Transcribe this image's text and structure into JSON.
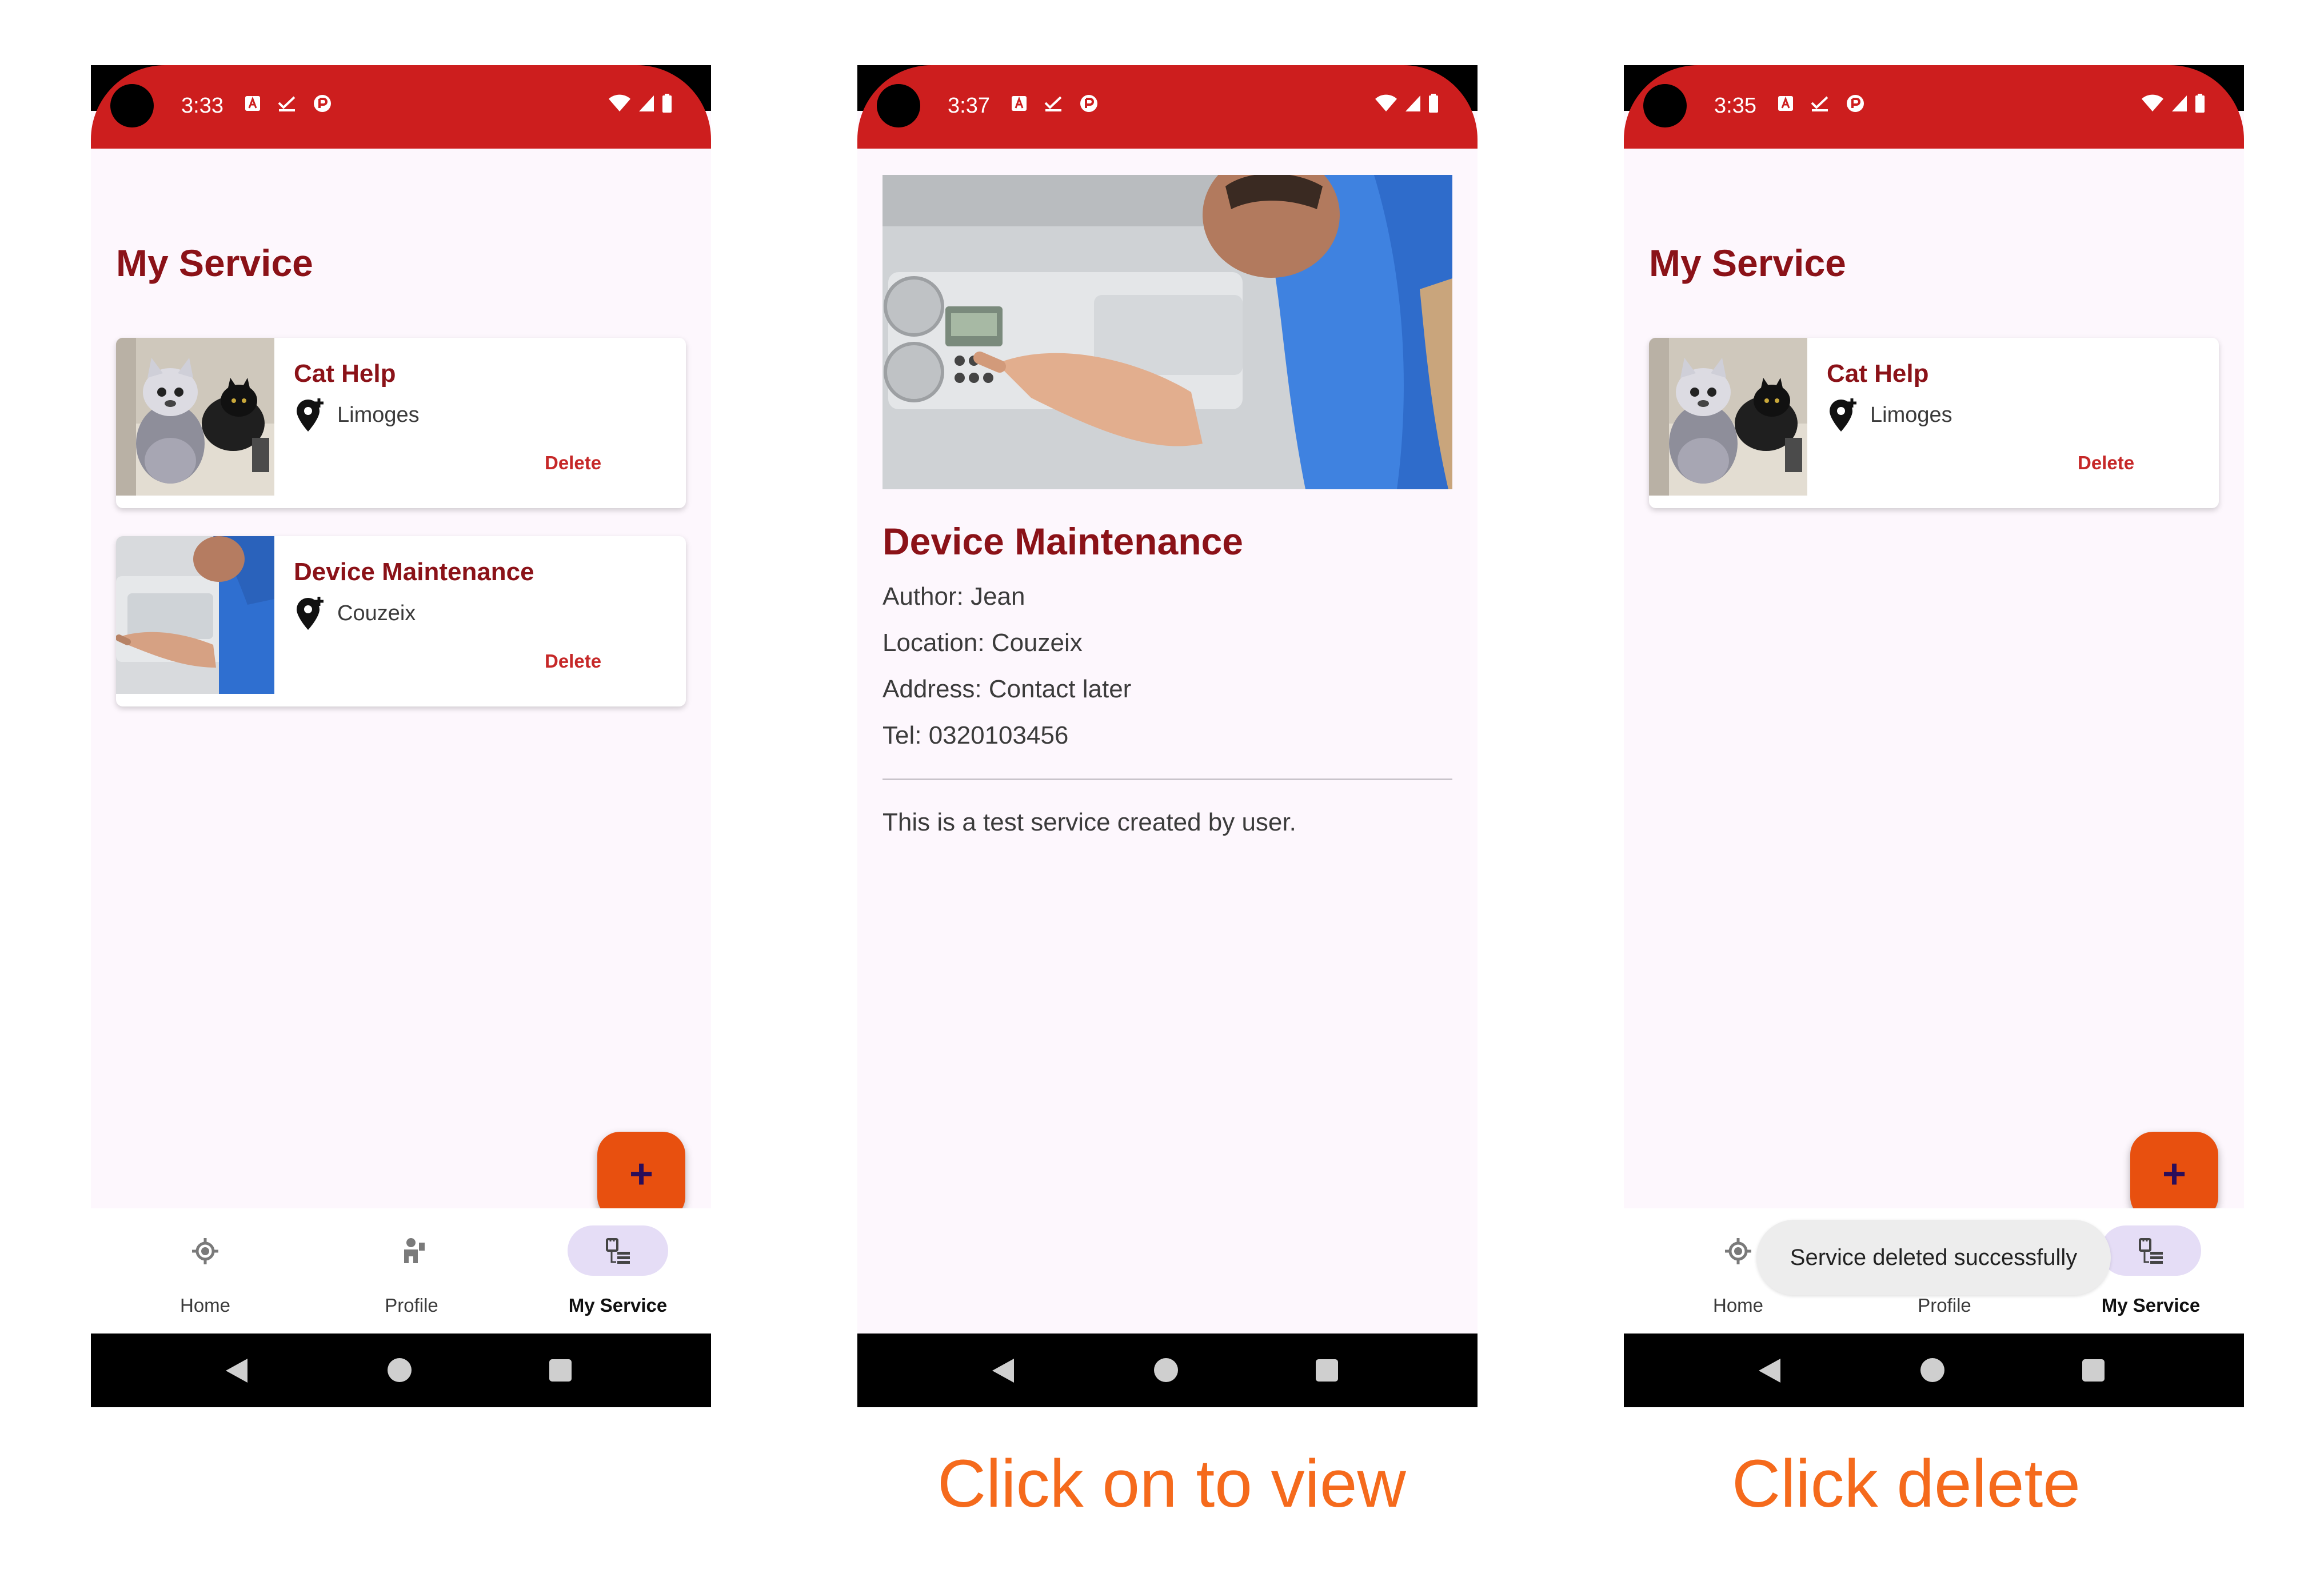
{
  "screens": [
    {
      "status": {
        "time": "3:33"
      },
      "title": "My Service",
      "cards": [
        {
          "title": "Cat Help",
          "location": "Limoges",
          "action": "Delete",
          "thumbnail": "cat-photo"
        },
        {
          "title": "Device Maintenance",
          "location": "Couzeix",
          "action": "Delete",
          "thumbnail": "device-photo"
        }
      ],
      "fab": {
        "icon": "plus-icon",
        "symbol": "+"
      },
      "nav": [
        {
          "label": "Home",
          "icon": "crosshair-icon",
          "active": false
        },
        {
          "label": "Profile",
          "icon": "person-icon",
          "active": false
        },
        {
          "label": "My Service",
          "icon": "service-list-icon",
          "active": true
        }
      ]
    },
    {
      "status": {
        "time": "3:37"
      },
      "detail": {
        "image": "device-photo",
        "title": "Device Maintenance",
        "author": "Author: Jean",
        "location": "Location: Couzeix",
        "address": "Address: Contact later",
        "tel": "Tel: 0320103456",
        "description": "This is a test service created by user."
      }
    },
    {
      "status": {
        "time": "3:35"
      },
      "title": "My Service",
      "cards": [
        {
          "title": "Cat Help",
          "location": "Limoges",
          "action": "Delete",
          "thumbnail": "cat-photo"
        }
      ],
      "fab": {
        "icon": "plus-icon",
        "symbol": "+"
      },
      "nav": [
        {
          "label": "Home",
          "icon": "crosshair-icon",
          "active": false
        },
        {
          "label": "Profile",
          "icon": "person-icon",
          "active": false
        },
        {
          "label": "My Service",
          "icon": "service-list-icon",
          "active": true
        }
      ],
      "toast": "Service deleted successfully"
    }
  ],
  "captions": [
    "Click on to view",
    "Click delete"
  ],
  "colors": {
    "status_bar": "#cd1e1e",
    "title": "#8b1218",
    "delete": "#c62828",
    "fab": "#e8500f",
    "caption": "#f56a1c",
    "nav_active_pill": "#e5ddf6",
    "background": "#fdf7fd"
  }
}
